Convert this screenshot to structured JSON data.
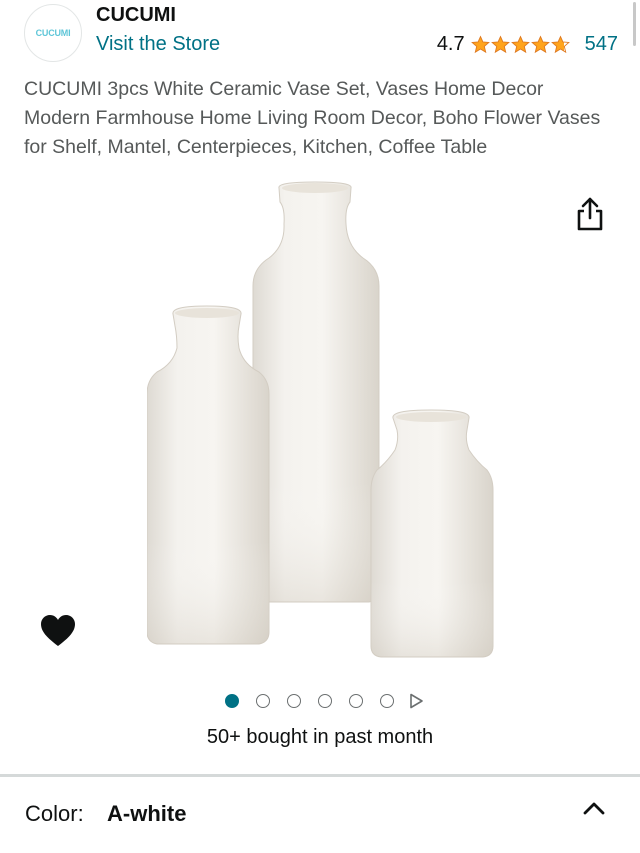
{
  "store": {
    "logo_text": "CUCUMI",
    "name": "CUCUMI",
    "visit_label": "Visit the Store"
  },
  "rating": {
    "value": "4.7",
    "stars": 4.7,
    "count": "547",
    "star_color": "#ffa41c"
  },
  "product": {
    "title": "CUCUMI 3pcs White Ceramic Vase Set, Vases Home Decor Modern Farmhouse Home Living Room Decor, Boho Flower Vases for Shelf, Mantel, Centerpieces, Kitchen, Coffee Table",
    "bought_text": "50+ bought in past month"
  },
  "gallery": {
    "current_index": 1,
    "total_images": 6,
    "has_video": true
  },
  "icons": {
    "share": "share-icon",
    "wishlist": "heart-icon",
    "video": "play-icon",
    "expand": "chevron-up-icon"
  },
  "variation": {
    "label": "Color:",
    "value": "A-white"
  },
  "colors": {
    "link": "#007185",
    "text": "#0f1111",
    "muted": "#565959",
    "divider": "#d5d9d9"
  }
}
